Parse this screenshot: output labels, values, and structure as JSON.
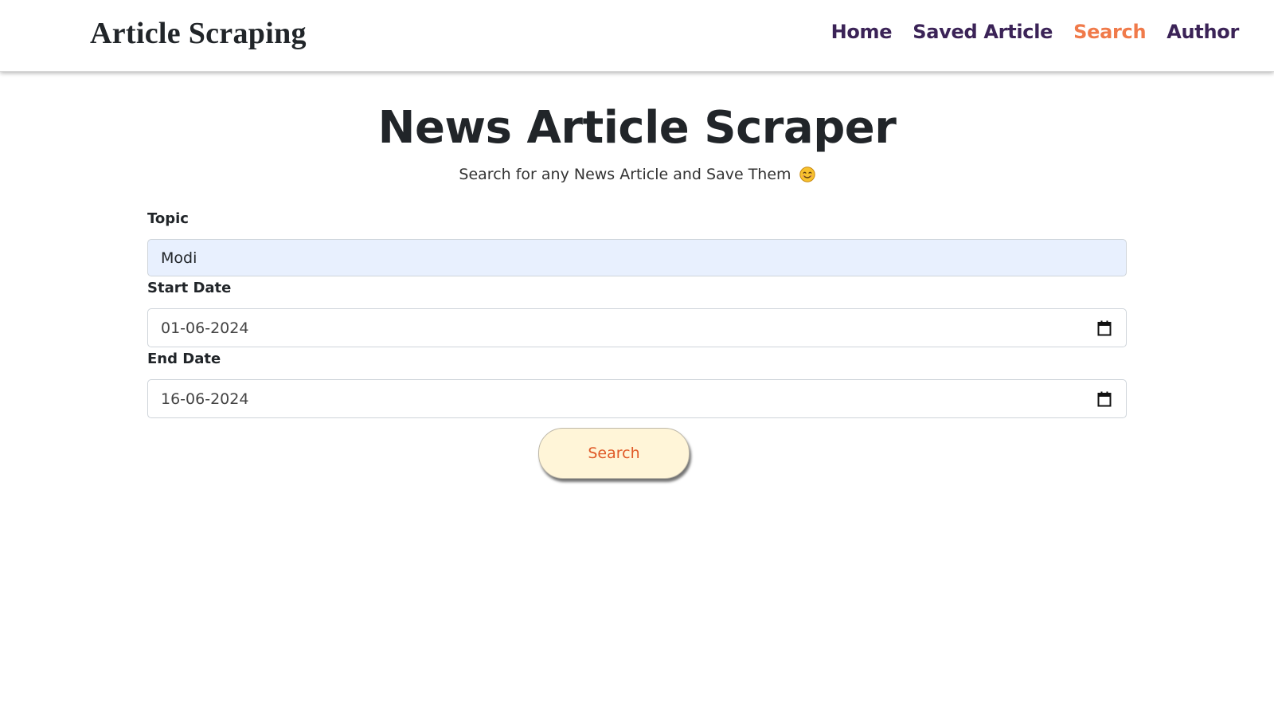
{
  "navbar": {
    "brand": "Article Scraping",
    "links": [
      {
        "label": "Home",
        "active": false
      },
      {
        "label": "Saved Article",
        "active": false
      },
      {
        "label": "Search",
        "active": true
      },
      {
        "label": "Author",
        "active": false
      }
    ],
    "link_color": "#3b2357",
    "active_color": "#f07a4a"
  },
  "main": {
    "title": "News Article Scraper",
    "subtitle": "Search for any News Article and Save Them",
    "subtitle_icon": "smiley-emoji-icon"
  },
  "form": {
    "topic_label": "Topic",
    "topic_value": "Modi",
    "start_label": "Start Date",
    "start_value": "01-06-2024",
    "end_label": "End Date",
    "end_value": "16-06-2024",
    "date_icon": "calendar-icon",
    "submit_label": "Search"
  }
}
